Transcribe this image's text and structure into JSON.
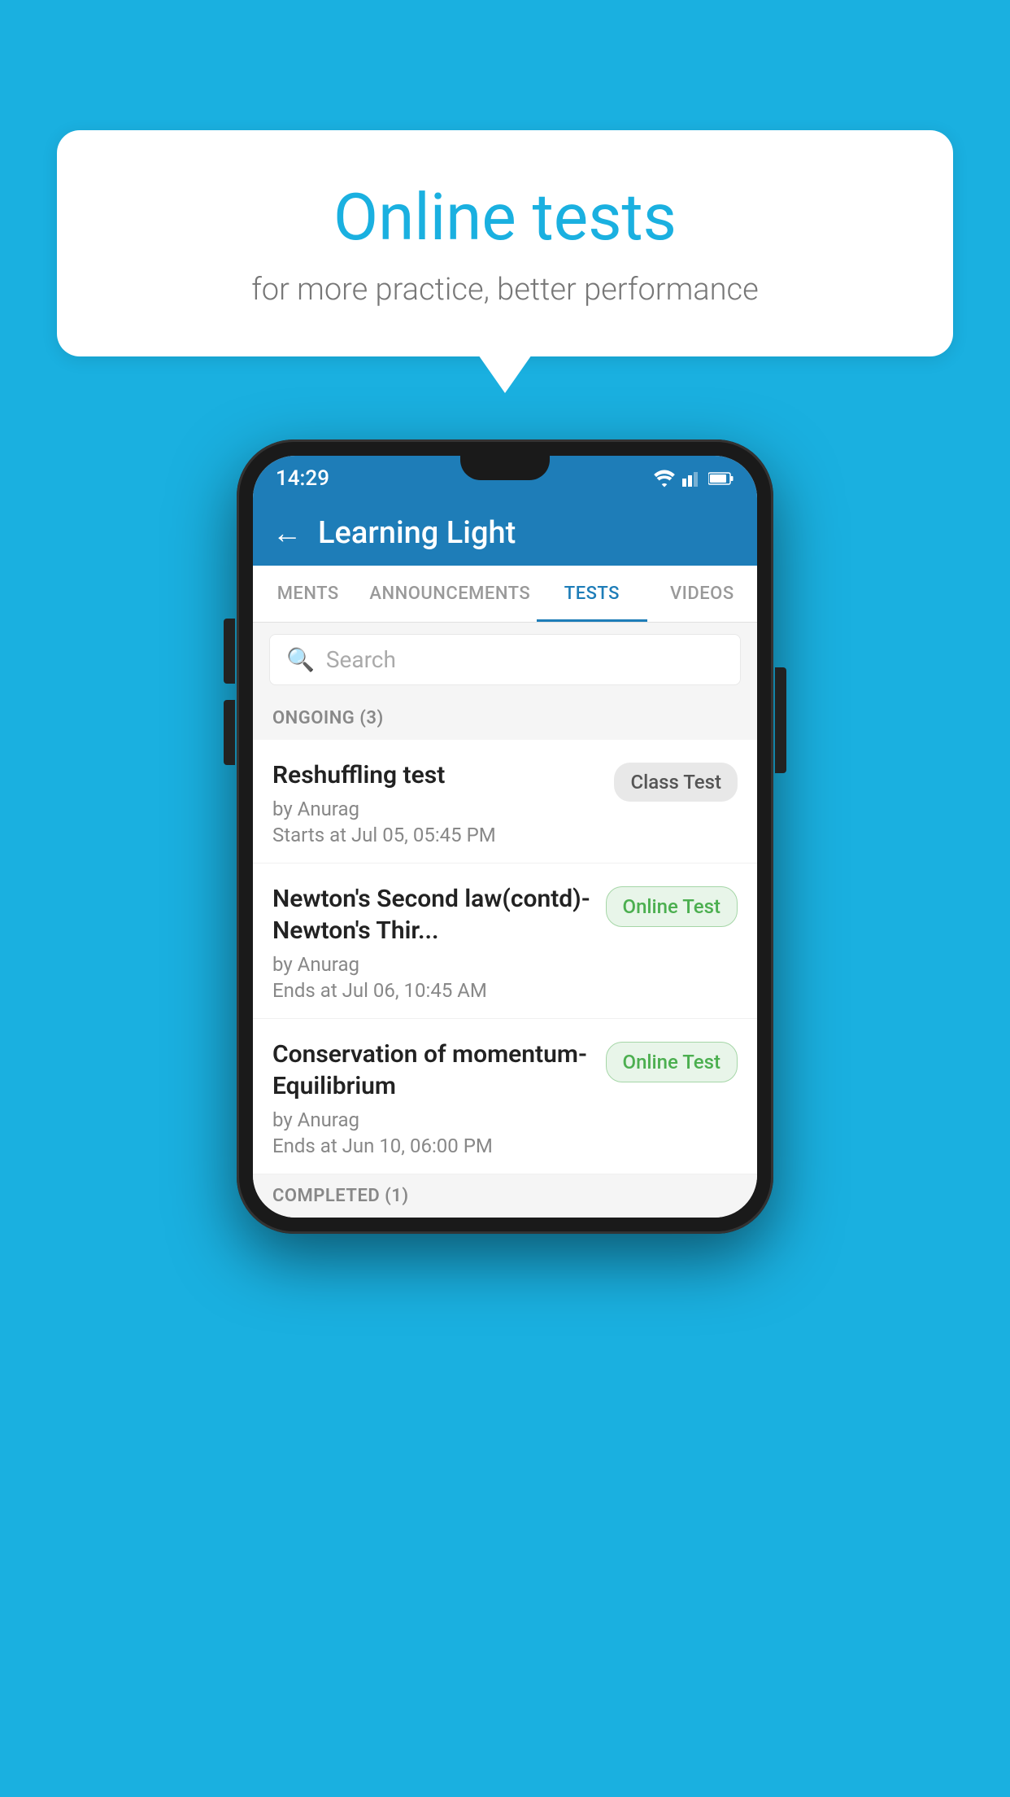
{
  "background_color": "#1ab0e0",
  "speech_bubble": {
    "title": "Online tests",
    "subtitle": "for more practice, better performance"
  },
  "phone": {
    "status_bar": {
      "time": "14:29"
    },
    "header": {
      "title": "Learning Light",
      "back_label": "←"
    },
    "tabs": [
      {
        "label": "MENTS",
        "active": false
      },
      {
        "label": "ANNOUNCEMENTS",
        "active": false
      },
      {
        "label": "TESTS",
        "active": true
      },
      {
        "label": "VIDEOS",
        "active": false
      }
    ],
    "search": {
      "placeholder": "Search"
    },
    "ongoing_section": {
      "label": "ONGOING (3)"
    },
    "test_items": [
      {
        "name": "Reshuffling test",
        "by": "by Anurag",
        "time_label": "Starts at",
        "time": "Jul 05, 05:45 PM",
        "badge": "Class Test",
        "badge_type": "class"
      },
      {
        "name": "Newton's Second law(contd)-Newton's Thir...",
        "by": "by Anurag",
        "time_label": "Ends at",
        "time": "Jul 06, 10:45 AM",
        "badge": "Online Test",
        "badge_type": "online"
      },
      {
        "name": "Conservation of momentum-Equilibrium",
        "by": "by Anurag",
        "time_label": "Ends at",
        "time": "Jun 10, 06:00 PM",
        "badge": "Online Test",
        "badge_type": "online"
      }
    ],
    "completed_section": {
      "label": "COMPLETED (1)"
    }
  }
}
